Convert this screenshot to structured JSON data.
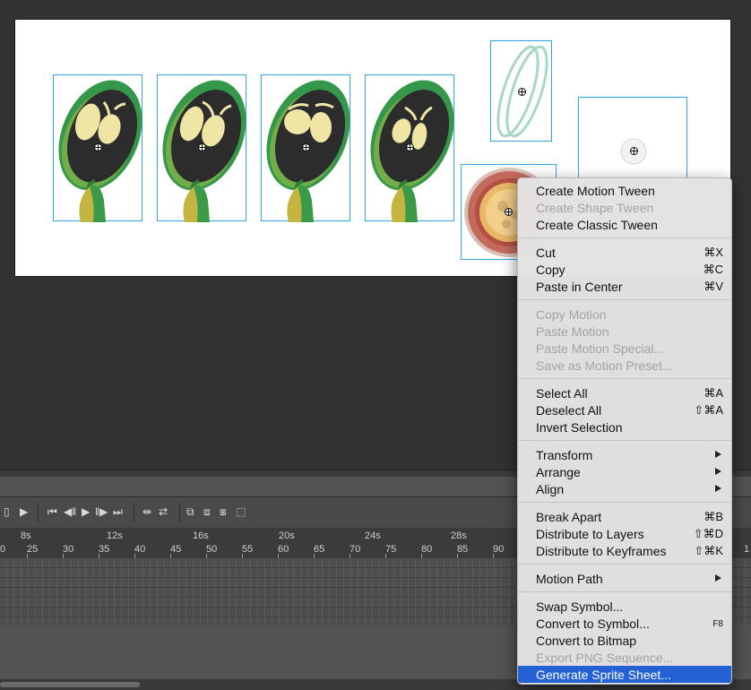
{
  "timeline": {
    "seconds": [
      "8s",
      "12s",
      "16s",
      "20s",
      "24s",
      "28s"
    ],
    "frames": [
      "0",
      "25",
      "30",
      "35",
      "40",
      "45",
      "50",
      "55",
      "60",
      "65",
      "70",
      "75",
      "80",
      "85",
      "90",
      "1"
    ]
  },
  "context_menu": {
    "groups": [
      {
        "items": [
          {
            "label": "Create Motion Tween",
            "shortcut": "",
            "enabled": true
          },
          {
            "label": "Create Shape Tween",
            "shortcut": "",
            "enabled": false
          },
          {
            "label": "Create Classic Tween",
            "shortcut": "",
            "enabled": true
          }
        ]
      },
      {
        "items": [
          {
            "label": "Cut",
            "shortcut": "⌘X",
            "enabled": true
          },
          {
            "label": "Copy",
            "shortcut": "⌘C",
            "enabled": true
          },
          {
            "label": "Paste in Center",
            "shortcut": "⌘V",
            "enabled": true
          }
        ]
      },
      {
        "items": [
          {
            "label": "Copy Motion",
            "shortcut": "",
            "enabled": false
          },
          {
            "label": "Paste Motion",
            "shortcut": "",
            "enabled": false
          },
          {
            "label": "Paste Motion Special...",
            "shortcut": "",
            "enabled": false
          },
          {
            "label": "Save as Motion Preset...",
            "shortcut": "",
            "enabled": false
          }
        ]
      },
      {
        "items": [
          {
            "label": "Select All",
            "shortcut": "⌘A",
            "enabled": true
          },
          {
            "label": "Deselect All",
            "shortcut": "⇧⌘A",
            "enabled": true
          },
          {
            "label": "Invert Selection",
            "shortcut": "",
            "enabled": true
          }
        ]
      },
      {
        "items": [
          {
            "label": "Transform",
            "shortcut": "",
            "enabled": true,
            "submenu": true
          },
          {
            "label": "Arrange",
            "shortcut": "",
            "enabled": true,
            "submenu": true
          },
          {
            "label": "Align",
            "shortcut": "",
            "enabled": true,
            "submenu": true
          }
        ]
      },
      {
        "items": [
          {
            "label": "Break Apart",
            "shortcut": "⌘B",
            "enabled": true
          },
          {
            "label": "Distribute to Layers",
            "shortcut": "⇧⌘D",
            "enabled": true
          },
          {
            "label": "Distribute to Keyframes",
            "shortcut": "⇧⌘K",
            "enabled": true
          }
        ]
      },
      {
        "items": [
          {
            "label": "Motion Path",
            "shortcut": "",
            "enabled": true,
            "submenu": true
          }
        ]
      },
      {
        "items": [
          {
            "label": "Swap Symbol...",
            "shortcut": "",
            "enabled": true
          },
          {
            "label": "Convert to Symbol...",
            "shortcut": "F8",
            "enabled": true
          },
          {
            "label": "Convert to Bitmap",
            "shortcut": "",
            "enabled": true
          },
          {
            "label": "Export PNG Sequence...",
            "shortcut": "",
            "enabled": false
          },
          {
            "label": "Generate Sprite Sheet...",
            "shortcut": "",
            "enabled": true,
            "highlighted": true
          }
        ]
      }
    ]
  },
  "colors": {
    "accent": "#2361d4",
    "selection_box": "#2fa4e7",
    "character_green": "#3a9a48",
    "character_yellow": "#e8e2a8",
    "orb_red": "#c46a5c",
    "orb_gold": "#e8b868",
    "ring_teal": "#a9d6c8"
  }
}
